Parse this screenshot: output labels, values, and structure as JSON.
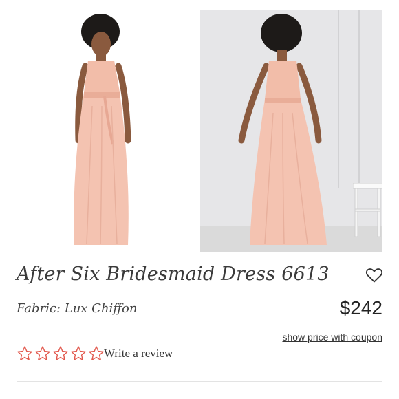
{
  "product": {
    "title": "After Six Bridesmaid Dress 6613",
    "fabric": "Fabric: Lux Chiffon",
    "price": "$242",
    "coupon_link": "show price with coupon",
    "review_link": "Write a review",
    "rating_stars": 5,
    "rating_value": 0
  },
  "images": {
    "front_icon": "dress-front-photo",
    "back_icon": "dress-back-photo"
  },
  "icons": {
    "like": "heart-outline-icon",
    "star": "star-outline-icon"
  },
  "colors": {
    "dress": "#f4c3b1",
    "star_outline": "#e2574c",
    "backdrop": "#e6e6e8"
  }
}
